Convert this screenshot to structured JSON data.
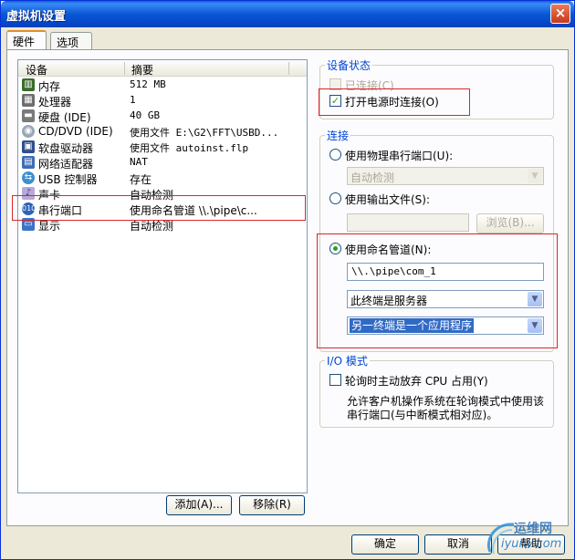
{
  "window": {
    "title": "虚拟机设置",
    "close": "×"
  },
  "tabs": [
    {
      "label": "硬件"
    },
    {
      "label": "选项"
    }
  ],
  "device_list": {
    "headers": {
      "device": "设备",
      "summary": "摘要"
    },
    "rows": [
      {
        "name": "内存",
        "summary": "512 MB",
        "icon": "memory-icon"
      },
      {
        "name": "处理器",
        "summary": "1",
        "icon": "cpu-icon"
      },
      {
        "name": "硬盘 (IDE)",
        "summary": "40 GB",
        "icon": "hard-disk-icon"
      },
      {
        "name": "CD/DVD (IDE)",
        "summary": "使用文件 E:\\G2\\FFT\\USBD...",
        "icon": "cd-dvd-icon"
      },
      {
        "name": "软盘驱动器",
        "summary": "使用文件 autoinst.flp",
        "icon": "floppy-icon"
      },
      {
        "name": "网络适配器",
        "summary": "NAT",
        "icon": "network-adapter-icon"
      },
      {
        "name": "USB 控制器",
        "summary": "存在",
        "icon": "usb-icon"
      },
      {
        "name": "声卡",
        "summary": "自动检测",
        "icon": "sound-card-icon"
      },
      {
        "name": "串行端口",
        "summary": "使用命名管道 \\\\.\\pipe\\c...",
        "icon": "serial-port-icon"
      },
      {
        "name": "显示",
        "summary": "自动检测",
        "icon": "display-icon"
      }
    ],
    "selected_index": 8
  },
  "buttons": {
    "add": "添加(A)...",
    "remove": "移除(R)",
    "ok": "确定",
    "cancel": "取消",
    "help": "帮助"
  },
  "device_status": {
    "title": "设备状态",
    "connected_label": "已连接(C)",
    "connect_on_power": "打开电源时连接(O)"
  },
  "connection": {
    "title": "连接",
    "physical_port": "使用物理串行端口(U):",
    "physical_select": "自动检测",
    "output_file": "使用输出文件(S):",
    "browse": "浏览(B)...",
    "named_pipe": "使用命名管道(N):",
    "pipe_name": "\\\\.\\pipe\\com_1",
    "endpoint": "此终端是服务器",
    "other_end": "另一终端是一个应用程序"
  },
  "io_mode": {
    "title": "I/O 模式",
    "yield_cpu": "轮询时主动放弃 CPU 占用(Y)",
    "description_line1": "允许客户机操作系统在轮询模式中使用该",
    "description_line2": "串行端口(与中断模式相对应)。"
  },
  "watermark": {
    "text": "运维网",
    "url": "iyunv.com"
  },
  "colors": {
    "accent": "#0046d5",
    "highlight_box": "#d9262a",
    "title_bar": "#0a57d4"
  }
}
